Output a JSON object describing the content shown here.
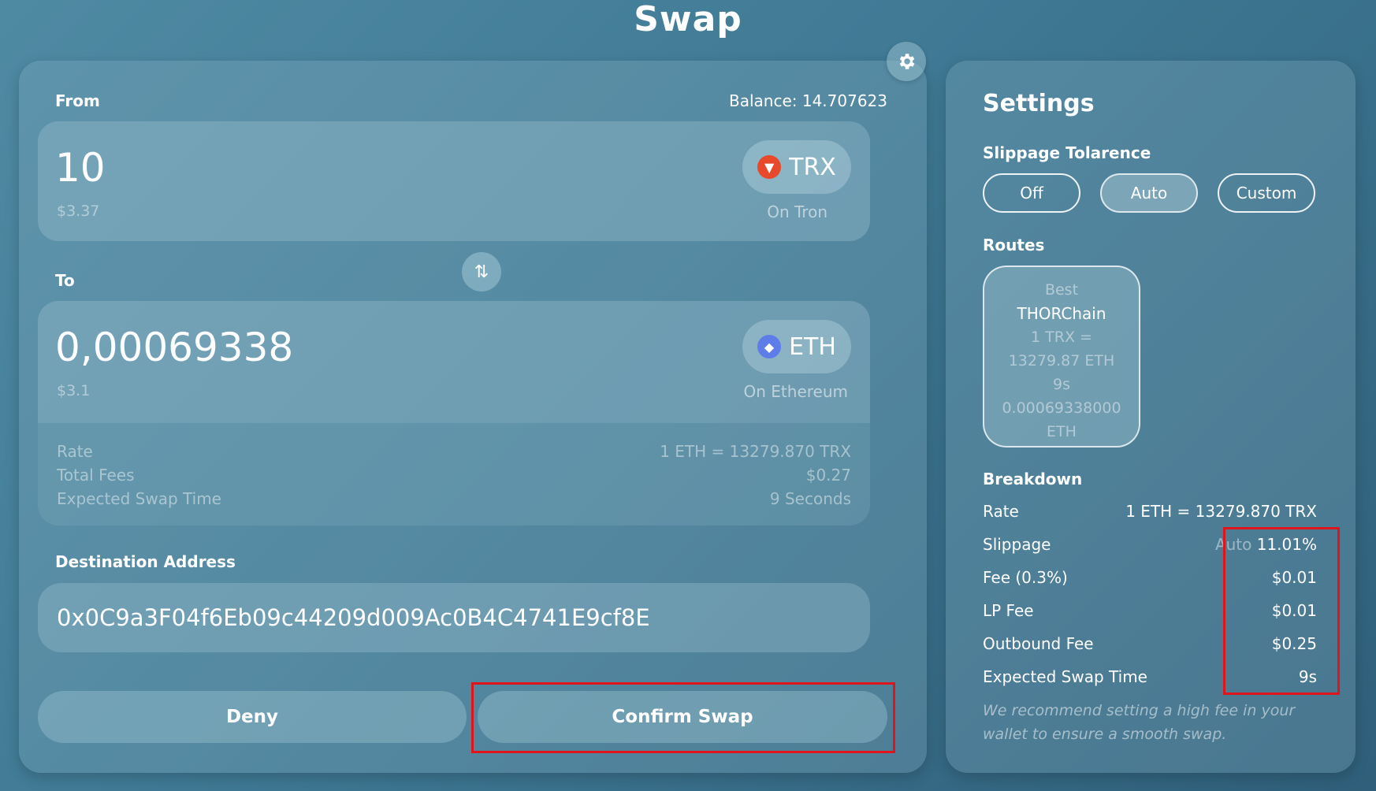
{
  "page": {
    "title": "Swap"
  },
  "from": {
    "label": "From",
    "balance": "Balance: 14.707623",
    "amount": "10",
    "usd": "$3.37",
    "token": "TRX",
    "chain": "On Tron"
  },
  "to": {
    "label": "To",
    "amount": "0,00069338",
    "usd": "$3.1",
    "token": "ETH",
    "chain": "On Ethereum"
  },
  "summary": {
    "rows": [
      {
        "label": "Rate",
        "value": "1 ETH = 13279.870 TRX"
      },
      {
        "label": "Total Fees",
        "value": "$0.27"
      },
      {
        "label": "Expected Swap Time",
        "value": "9 Seconds"
      }
    ]
  },
  "destination": {
    "label": "Destination Address",
    "address": "0x0C9a3F04f6Eb09c44209d009Ac0B4C4741E9cf8E"
  },
  "actions": {
    "deny": "Deny",
    "confirm": "Confirm Swap"
  },
  "settings": {
    "title": "Settings",
    "slippage": {
      "label": "Slippage Tolarence",
      "options": [
        "Off",
        "Auto",
        "Custom"
      ],
      "selected": "Auto"
    },
    "routes": {
      "label": "Routes",
      "items": [
        {
          "tag": "Best",
          "provider": "THORChain",
          "rate_line1": "1 TRX =",
          "rate_line2": "13279.87 ETH",
          "time": "9s",
          "amount_line1": "0.00069338000",
          "amount_line2": "ETH"
        }
      ]
    },
    "breakdown": {
      "label": "Breakdown",
      "rows": [
        {
          "label": "Rate",
          "value": "1 ETH = 13279.870 TRX"
        },
        {
          "label": "Slippage",
          "prefix": "Auto",
          "value": "11.01%"
        },
        {
          "label": "Fee (0.3%)",
          "value": "$0.01"
        },
        {
          "label": "LP Fee",
          "value": "$0.01"
        },
        {
          "label": "Outbound Fee",
          "value": "$0.25"
        },
        {
          "label": "Expected Swap Time",
          "value": "9s"
        }
      ],
      "note": "We recommend setting a high fee in your wallet to ensure a smooth swap."
    }
  },
  "colors": {
    "background_top": "#4f8aa3",
    "background_bottom": "#2f5f7a",
    "highlight_frame": "#e0151b",
    "trx_brand": "#e8492b",
    "eth_brand": "#5f7de8"
  }
}
